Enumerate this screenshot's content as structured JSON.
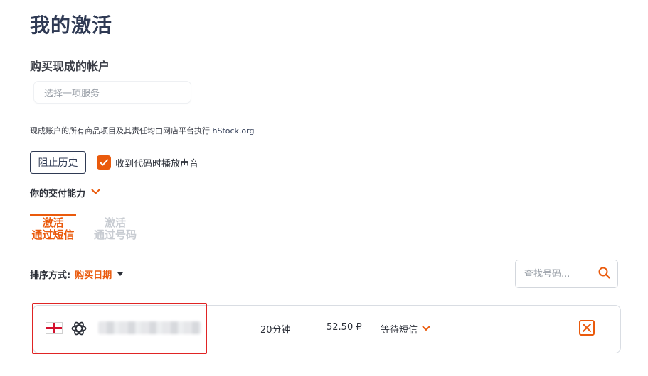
{
  "header": {
    "title": "我的激活"
  },
  "buy_section": {
    "title": "购买现成的帐户",
    "select_placeholder": "选择一项服务",
    "disclaimer": "现成账户的所有商品项目及其责任均由网店平台执行",
    "disclaimer_link": "hStock.org"
  },
  "controls": {
    "history_button": "阻止历史",
    "sound_checkbox_label": "收到代码时播放声音",
    "sound_checked": true,
    "delivery_label": "你的交付能力"
  },
  "tabs": [
    {
      "line1": "激活",
      "line2": "通过短信",
      "active": true
    },
    {
      "line1": "激活",
      "line2": "通过号码",
      "active": false
    }
  ],
  "sort": {
    "label": "排序方式:",
    "value": "购买日期"
  },
  "search": {
    "placeholder": "查找号码..."
  },
  "activations": [
    {
      "country_flag": "england-flag-icon",
      "service_icon": "openai-icon",
      "duration": "20分钟",
      "price": "52.50 ₽",
      "status": "等待短信"
    }
  ],
  "colors": {
    "accent": "#ea5a0c",
    "title": "#2f3a54",
    "highlight": "#e02424"
  }
}
